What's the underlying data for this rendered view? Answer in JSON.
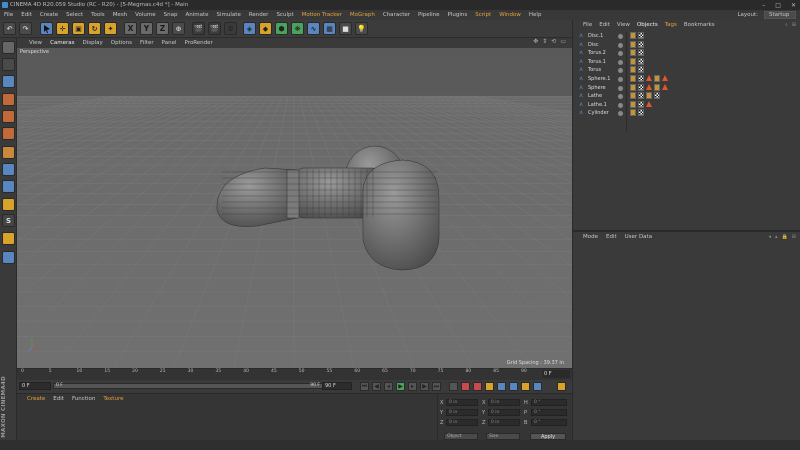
{
  "window": {
    "title": "CINEMA 4D R20.059 Studio (RC - R20) - [5-Megmas.c4d *] - Main",
    "controls": [
      "–",
      "□",
      "✕"
    ]
  },
  "menu": {
    "items": [
      "File",
      "Edit",
      "Create",
      "Select",
      "Tools",
      "Mesh",
      "Volume",
      "Snap",
      "Animate",
      "Simulate",
      "Render",
      "Sculpt",
      "Motion Tracker",
      "MoGraph",
      "Character",
      "Pipeline",
      "Plugins",
      "Script",
      "Window",
      "Help"
    ],
    "highlighted": [
      "Motion Tracker",
      "MoGraph",
      "Script",
      "Window"
    ],
    "layout_label": "Layout:",
    "layout_value": "Startup"
  },
  "toolbar": {
    "axis_x": "X",
    "axis_y": "Y",
    "axis_z": "Z"
  },
  "viewport": {
    "menu": [
      "View",
      "Cameras",
      "Display",
      "Options",
      "Filter",
      "Panel",
      "ProRender"
    ],
    "selected_menu": "Cameras",
    "camera_label": "Perspective",
    "grid_spacing": "Grid Spacing : 39.37 in"
  },
  "timeline": {
    "ticks": [
      "0",
      "5",
      "10",
      "15",
      "20",
      "25",
      "30",
      "35",
      "40",
      "45",
      "50",
      "55",
      "60",
      "65",
      "70",
      "75",
      "80",
      "85",
      "90"
    ],
    "current_frame": "0 F"
  },
  "transport": {
    "start": "0 F",
    "min": "0 F",
    "max": "90 F",
    "end": "90 F"
  },
  "materials": {
    "menu": [
      "Create",
      "Edit",
      "Function",
      "Texture"
    ],
    "highlighted": [
      "Create",
      "Texture"
    ]
  },
  "coordinates": {
    "axis_labels": [
      "X",
      "Y",
      "Z"
    ],
    "pos_vals": [
      "0 in",
      "0 in",
      "0 in"
    ],
    "size_axis_labels": [
      "X",
      "Y",
      "Z"
    ],
    "size_vals": [
      "0 in",
      "0 in",
      "0 in"
    ],
    "rot_labels": [
      "H",
      "P",
      "B"
    ],
    "rot_vals": [
      "0 °",
      "0 °",
      "0 °"
    ],
    "dropdown_object": "Object",
    "dropdown_size": "Size",
    "apply": "Apply"
  },
  "objects": {
    "menu": [
      "File",
      "Edit",
      "View",
      "Objects",
      "Tags",
      "Bookmarks"
    ],
    "selected_menu": "Objects",
    "highlighted": [
      "Objects",
      "Tags"
    ],
    "rows": [
      {
        "name": "Disc.1",
        "tags": [
          "mat",
          "chk"
        ],
        "warn": false
      },
      {
        "name": "Disc",
        "tags": [
          "mat",
          "chk"
        ],
        "warn": false
      },
      {
        "name": "Torus.2",
        "tags": [
          "mat",
          "chk"
        ],
        "warn": false
      },
      {
        "name": "Torus.1",
        "tags": [
          "mat",
          "chk"
        ],
        "warn": false
      },
      {
        "name": "Torus",
        "tags": [
          "mat",
          "chk"
        ],
        "warn": false
      },
      {
        "name": "Sphere.1",
        "tags": [
          "mat",
          "chk",
          "warn",
          "mat",
          "warn"
        ],
        "warn": true
      },
      {
        "name": "Sphere",
        "tags": [
          "mat",
          "chk",
          "warn",
          "mat",
          "warn"
        ],
        "warn": true
      },
      {
        "name": "Lathe",
        "tags": [
          "mat",
          "chk",
          "mat",
          "chk"
        ],
        "warn": false
      },
      {
        "name": "Lathe.1",
        "tags": [
          "mat",
          "chk",
          "warn"
        ],
        "warn": true
      },
      {
        "name": "Cylinder",
        "tags": [
          "mat",
          "chk"
        ],
        "warn": false
      }
    ]
  },
  "attributes": {
    "menu": [
      "Mode",
      "Edit",
      "User Data"
    ]
  },
  "colors": {
    "accent_orange": "#e8a33a",
    "active_blue": "#5a86c0",
    "bg": "#3a3a3a",
    "viewport_bg": "#6e6e6e"
  }
}
